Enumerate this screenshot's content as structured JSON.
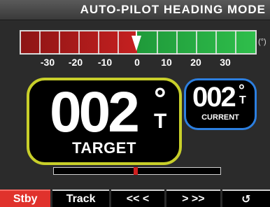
{
  "header": {
    "title": "AUTO-PILOT HEADING MODE"
  },
  "scale": {
    "labels": [
      "-30",
      "-20",
      "-10",
      "0",
      "10",
      "20",
      "30"
    ],
    "unit": "(°)"
  },
  "target": {
    "value": "002",
    "degree": "°",
    "ref": "T",
    "label": "TARGET"
  },
  "current": {
    "value": "002",
    "degree": "°",
    "ref": "T",
    "label": "CURRENT"
  },
  "softkeys": {
    "stby": "Stby",
    "track": "Track",
    "left": "<<  <",
    "right": ">  >>",
    "undo": "↺"
  },
  "colors": {
    "port": "#c52020",
    "starboard": "#2fbe4b",
    "target_border": "#c8cf2a",
    "current_border": "#2c7fe0",
    "stby_key": "#e0322c"
  }
}
